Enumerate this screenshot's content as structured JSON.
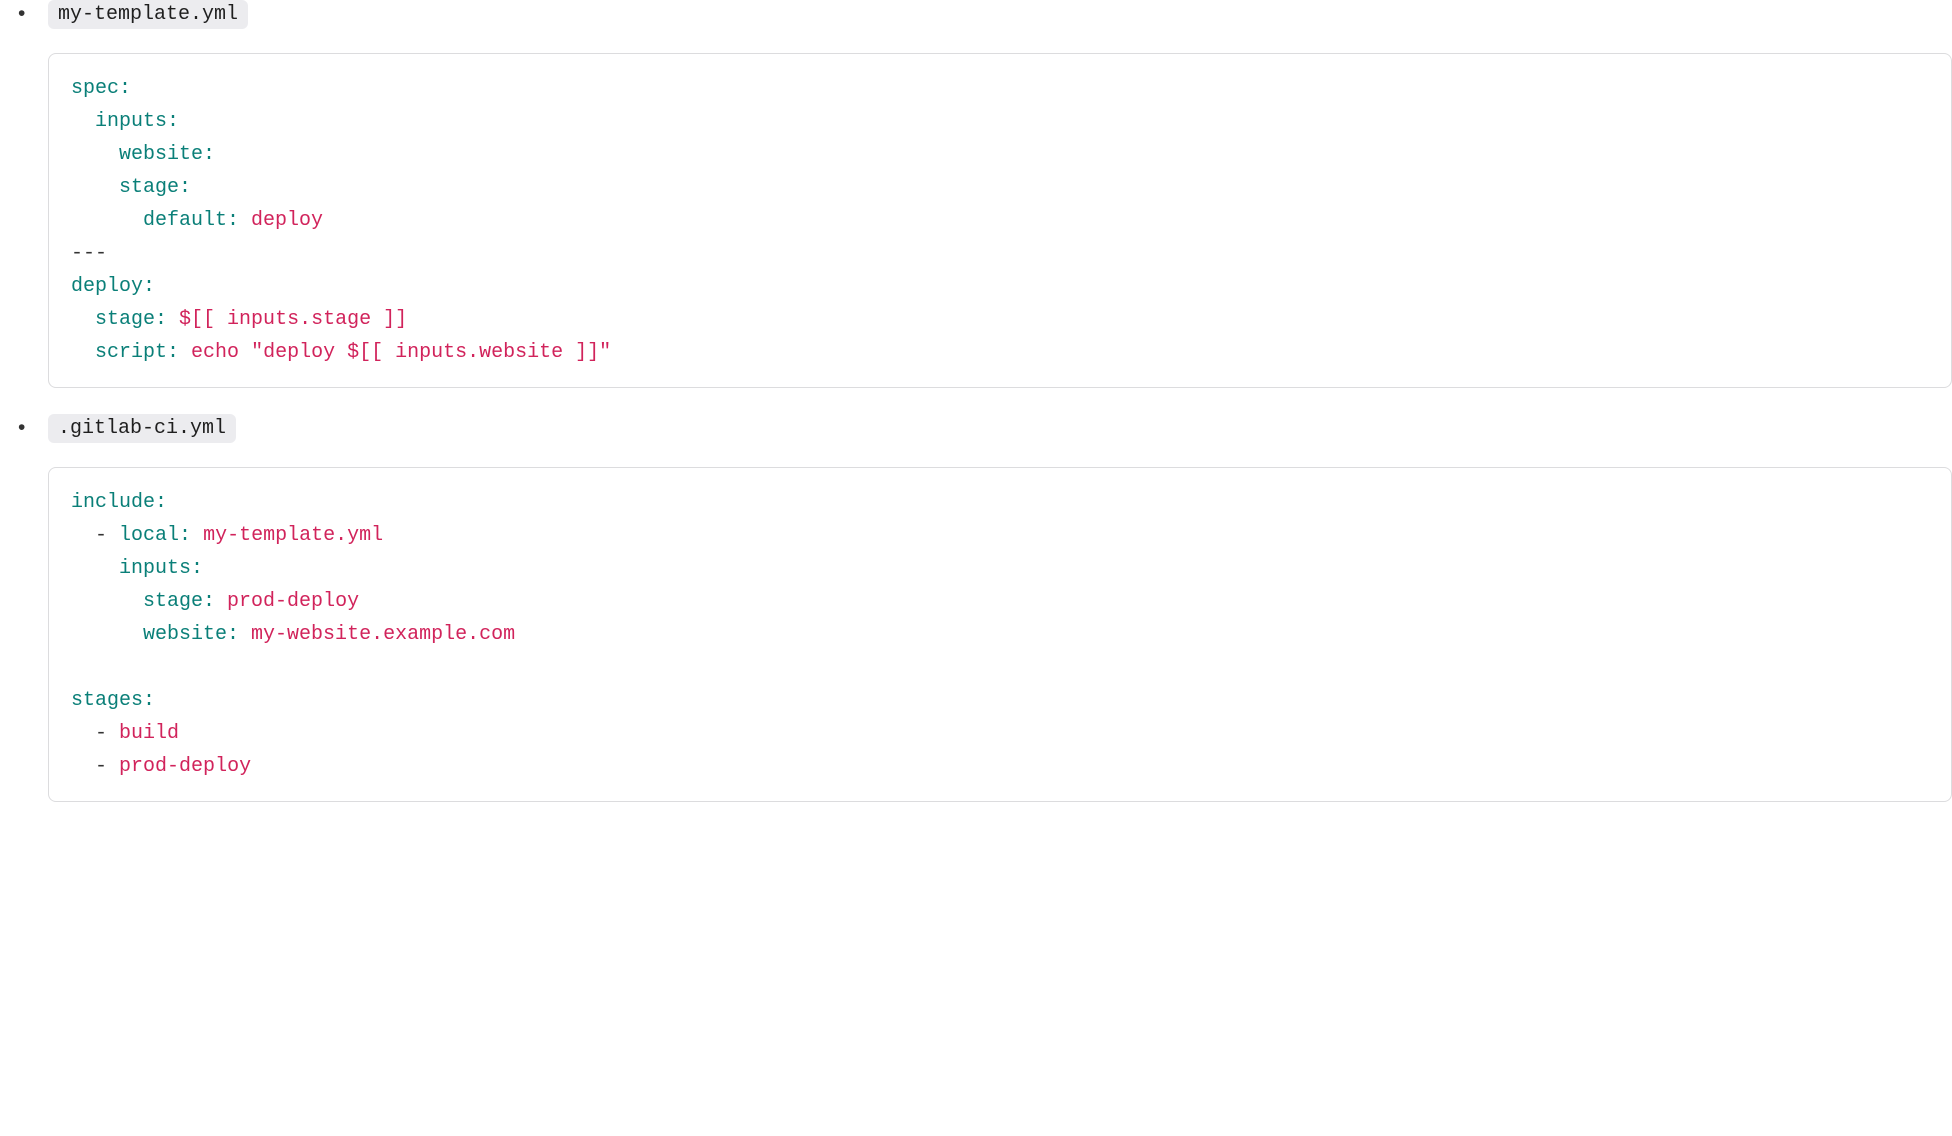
{
  "items": [
    {
      "filename": "my-template.yml",
      "tokens": [
        [
          [
            "k",
            "spec:"
          ]
        ],
        [
          [
            "p",
            "  "
          ],
          [
            "k",
            "inputs:"
          ]
        ],
        [
          [
            "p",
            "    "
          ],
          [
            "k",
            "website:"
          ]
        ],
        [
          [
            "p",
            "    "
          ],
          [
            "k",
            "stage:"
          ]
        ],
        [
          [
            "p",
            "      "
          ],
          [
            "k",
            "default:"
          ],
          [
            "p",
            " "
          ],
          [
            "v",
            "deploy"
          ]
        ],
        [
          [
            "p",
            "---"
          ]
        ],
        [
          [
            "k",
            "deploy:"
          ]
        ],
        [
          [
            "p",
            "  "
          ],
          [
            "k",
            "stage:"
          ],
          [
            "p",
            " "
          ],
          [
            "v",
            "$[[ inputs.stage ]]"
          ]
        ],
        [
          [
            "p",
            "  "
          ],
          [
            "k",
            "script:"
          ],
          [
            "p",
            " "
          ],
          [
            "v",
            "echo"
          ],
          [
            "p",
            " "
          ],
          [
            "v",
            "\"deploy $[[ inputs.website ]]\""
          ]
        ]
      ]
    },
    {
      "filename": ".gitlab-ci.yml",
      "tokens": [
        [
          [
            "k",
            "include:"
          ]
        ],
        [
          [
            "p",
            "  "
          ],
          [
            "d",
            "-"
          ],
          [
            "p",
            " "
          ],
          [
            "k",
            "local:"
          ],
          [
            "p",
            " "
          ],
          [
            "v",
            "my-template.yml"
          ]
        ],
        [
          [
            "p",
            "    "
          ],
          [
            "k",
            "inputs:"
          ]
        ],
        [
          [
            "p",
            "      "
          ],
          [
            "k",
            "stage:"
          ],
          [
            "p",
            " "
          ],
          [
            "v",
            "prod-deploy"
          ]
        ],
        [
          [
            "p",
            "      "
          ],
          [
            "k",
            "website:"
          ],
          [
            "p",
            " "
          ],
          [
            "v",
            "my-website.example.com"
          ]
        ],
        [],
        [
          [
            "k",
            "stages:"
          ]
        ],
        [
          [
            "p",
            "  "
          ],
          [
            "d",
            "-"
          ],
          [
            "p",
            " "
          ],
          [
            "v",
            "build"
          ]
        ],
        [
          [
            "p",
            "  "
          ],
          [
            "d",
            "-"
          ],
          [
            "p",
            " "
          ],
          [
            "v",
            "prod-deploy"
          ]
        ]
      ]
    }
  ]
}
